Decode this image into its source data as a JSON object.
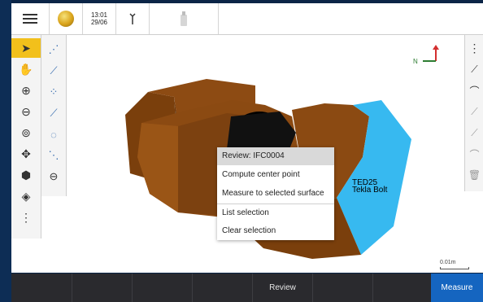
{
  "topbar": {
    "time": "13:01",
    "date": "29/06"
  },
  "context_menu": {
    "items": [
      {
        "label": "Review: IFC0004",
        "highlighted": true
      },
      {
        "label": "Compute center point"
      },
      {
        "label": "Measure to selected surface"
      },
      {
        "label": "List selection"
      },
      {
        "label": "Clear selection"
      }
    ]
  },
  "model_label": {
    "line1": "TED25",
    "line2": "Tekla Bolt"
  },
  "compass": {
    "north_label": "N"
  },
  "scale_bar": {
    "label": "0.01m"
  },
  "bottom_bar": {
    "review_label": "Review",
    "measure_label": "Measure"
  },
  "colors": {
    "bolt_brown": "#8b4a12",
    "selected_face": "#37b9f0",
    "highlight_yellow": "#f2c01b",
    "measure_blue": "#1565c0"
  },
  "icons": {
    "left_tools": [
      "select-arrow-icon",
      "pan-hand-icon",
      "zoom-in-icon",
      "zoom-out-icon",
      "zoom-extents-icon",
      "orbit-icon",
      "cube-view-icon",
      "layers-icon",
      "more-vertical-icon"
    ],
    "left_tools2": [
      "snap-point-icon",
      "snap-line-icon",
      "snap-center-icon",
      "snap-end-icon",
      "snap-circle-icon",
      "snap-midline-icon",
      "minus-circle-icon"
    ],
    "right_tools": [
      "more-vertical-icon",
      "polyline-icon",
      "arc-icon",
      "line-disabled-icon",
      "offset-disabled-icon",
      "curve-disabled-icon",
      "delete-icon"
    ]
  }
}
